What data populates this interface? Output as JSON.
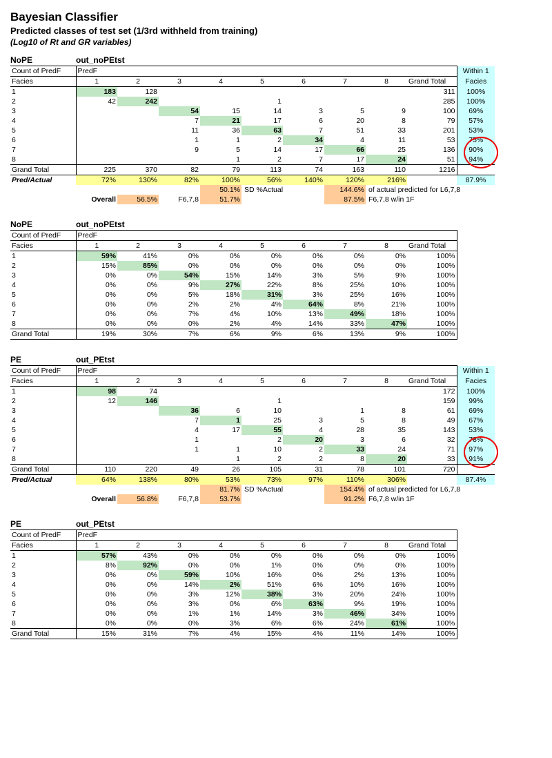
{
  "title": "Bayesian Classifier",
  "subtitle": "Predicted classes of test set (1/3rd withheld from training)",
  "subtitle2": "(Log10 of Rt and GR variables)",
  "labels": {
    "count": "Count of PredF",
    "predf": "PredF",
    "facies": "Facies",
    "gt": "Grand Total",
    "w1f": "Within 1 Facies",
    "pa": "Pred/Actual",
    "sd": "SD %Actual",
    "overall": "Overall",
    "f678": "F6,7,8",
    "note_act": "of actual predicted for L6,7,8",
    "note_w1f": "F6,7,8 w/in 1F"
  },
  "sections": [
    {
      "name": "NoPE",
      "dataset": "out_noPEtst",
      "rows": [
        {
          "f": 1,
          "v": [
            "183",
            "128",
            "",
            "",
            "",
            "",
            "",
            ""
          ],
          "gt": "311",
          "w": "100%",
          "d": 0
        },
        {
          "f": 2,
          "v": [
            "42",
            "242",
            "",
            "",
            "1",
            "",
            "",
            ""
          ],
          "gt": "285",
          "w": "100%",
          "d": 1
        },
        {
          "f": 3,
          "v": [
            "",
            "",
            "54",
            "15",
            "14",
            "3",
            "5",
            "9"
          ],
          "gt": "100",
          "w": "69%",
          "d": 2
        },
        {
          "f": 4,
          "v": [
            "",
            "",
            "7",
            "21",
            "17",
            "6",
            "20",
            "8"
          ],
          "gt": "79",
          "w": "57%",
          "d": 3
        },
        {
          "f": 5,
          "v": [
            "",
            "",
            "11",
            "36",
            "63",
            "7",
            "51",
            "33"
          ],
          "gt": "201",
          "w": "53%",
          "d": 4
        },
        {
          "f": 6,
          "v": [
            "",
            "",
            "1",
            "1",
            "2",
            "34",
            "4",
            "11"
          ],
          "gt": "53",
          "w": "75%",
          "d": 5
        },
        {
          "f": 7,
          "v": [
            "",
            "",
            "9",
            "5",
            "14",
            "17",
            "66",
            "25"
          ],
          "gt": "136",
          "w": "90%",
          "d": 6
        },
        {
          "f": 8,
          "v": [
            "",
            "",
            "",
            "1",
            "2",
            "7",
            "17",
            "24"
          ],
          "gt": "51",
          "w": "94%",
          "d": 7,
          "circ": true
        }
      ],
      "gtrow": [
        "225",
        "370",
        "82",
        "79",
        "113",
        "74",
        "163",
        "110",
        "1216"
      ],
      "pa": [
        "72%",
        "130%",
        "82%",
        "100%",
        "56%",
        "140%",
        "120%",
        "216%",
        "",
        "87.9%"
      ],
      "mid1": {
        "v4": "50.1%",
        "sd": "SD %Actual",
        "v7": "144.6%",
        "note": "of actual predicted for L6,7,8"
      },
      "mid2": {
        "ov": "Overall",
        "ovv": "56.5%",
        "f": "F6,7,8",
        "v4": "51.7%",
        "v7": "87.5%",
        "note": "F6,7,8 w/in 1F"
      }
    },
    {
      "name": "NoPE",
      "dataset": "out_noPEtst",
      "pct": true,
      "rows": [
        {
          "f": 1,
          "v": [
            "59%",
            "41%",
            "0%",
            "0%",
            "0%",
            "0%",
            "0%",
            "0%"
          ],
          "gt": "100%",
          "d": 0
        },
        {
          "f": 2,
          "v": [
            "15%",
            "85%",
            "0%",
            "0%",
            "0%",
            "0%",
            "0%",
            "0%"
          ],
          "gt": "100%",
          "d": 1
        },
        {
          "f": 3,
          "v": [
            "0%",
            "0%",
            "54%",
            "15%",
            "14%",
            "3%",
            "5%",
            "9%"
          ],
          "gt": "100%",
          "d": 2
        },
        {
          "f": 4,
          "v": [
            "0%",
            "0%",
            "9%",
            "27%",
            "22%",
            "8%",
            "25%",
            "10%"
          ],
          "gt": "100%",
          "d": 3
        },
        {
          "f": 5,
          "v": [
            "0%",
            "0%",
            "5%",
            "18%",
            "31%",
            "3%",
            "25%",
            "16%"
          ],
          "gt": "100%",
          "d": 4
        },
        {
          "f": 6,
          "v": [
            "0%",
            "0%",
            "2%",
            "2%",
            "4%",
            "64%",
            "8%",
            "21%"
          ],
          "gt": "100%",
          "d": 5
        },
        {
          "f": 7,
          "v": [
            "0%",
            "0%",
            "7%",
            "4%",
            "10%",
            "13%",
            "49%",
            "18%"
          ],
          "gt": "100%",
          "d": 6
        },
        {
          "f": 8,
          "v": [
            "0%",
            "0%",
            "0%",
            "2%",
            "4%",
            "14%",
            "33%",
            "47%"
          ],
          "gt": "100%",
          "d": 7
        }
      ],
      "gtrow": [
        "19%",
        "30%",
        "7%",
        "6%",
        "9%",
        "6%",
        "13%",
        "9%",
        "100%"
      ]
    },
    {
      "name": "PE",
      "dataset": "out_PEtst",
      "rows": [
        {
          "f": 1,
          "v": [
            "98",
            "74",
            "",
            "",
            "",
            "",
            "",
            ""
          ],
          "gt": "172",
          "w": "100%",
          "d": 0
        },
        {
          "f": 2,
          "v": [
            "12",
            "146",
            "",
            "",
            "1",
            "",
            "",
            ""
          ],
          "gt": "159",
          "w": "99%",
          "d": 1
        },
        {
          "f": 3,
          "v": [
            "",
            "",
            "36",
            "6",
            "10",
            "",
            "1",
            "8"
          ],
          "gt": "61",
          "w": "69%",
          "d": 2
        },
        {
          "f": 4,
          "v": [
            "",
            "",
            "7",
            "1",
            "25",
            "3",
            "5",
            "8"
          ],
          "gt": "49",
          "w": "67%",
          "d": 3
        },
        {
          "f": 5,
          "v": [
            "",
            "",
            "4",
            "17",
            "55",
            "4",
            "28",
            "35"
          ],
          "gt": "143",
          "w": "53%",
          "d": 4
        },
        {
          "f": 6,
          "v": [
            "",
            "",
            "1",
            "",
            "2",
            "20",
            "3",
            "6"
          ],
          "gt": "32",
          "w": "78%",
          "d": 5
        },
        {
          "f": 7,
          "v": [
            "",
            "",
            "1",
            "1",
            "10",
            "2",
            "33",
            "24"
          ],
          "gt": "71",
          "w": "97%",
          "d": 6
        },
        {
          "f": 8,
          "v": [
            "",
            "",
            "",
            "1",
            "2",
            "2",
            "8",
            "20"
          ],
          "gt": "33",
          "w": "91%",
          "d": 7,
          "circ": true
        }
      ],
      "gtrow": [
        "110",
        "220",
        "49",
        "26",
        "105",
        "31",
        "78",
        "101",
        "720"
      ],
      "pa": [
        "64%",
        "138%",
        "80%",
        "53%",
        "73%",
        "97%",
        "110%",
        "306%",
        "",
        "87.4%"
      ],
      "mid1": {
        "v4": "81.7%",
        "sd": "SD %Actual",
        "v7": "154.4%",
        "note": "of actual predicted for L6,7,8"
      },
      "mid2": {
        "ov": "Overall",
        "ovv": "56.8%",
        "f": "F6,7,8",
        "v4": "53.7%",
        "v7": "91.2%",
        "note": "F6,7,8 w/in 1F"
      }
    },
    {
      "name": "PE",
      "dataset": "out_PEtst",
      "pct": true,
      "rows": [
        {
          "f": 1,
          "v": [
            "57%",
            "43%",
            "0%",
            "0%",
            "0%",
            "0%",
            "0%",
            "0%"
          ],
          "gt": "100%",
          "d": 0
        },
        {
          "f": 2,
          "v": [
            "8%",
            "92%",
            "0%",
            "0%",
            "1%",
            "0%",
            "0%",
            "0%"
          ],
          "gt": "100%",
          "d": 1
        },
        {
          "f": 3,
          "v": [
            "0%",
            "0%",
            "59%",
            "10%",
            "16%",
            "0%",
            "2%",
            "13%"
          ],
          "gt": "100%",
          "d": 2
        },
        {
          "f": 4,
          "v": [
            "0%",
            "0%",
            "14%",
            "2%",
            "51%",
            "6%",
            "10%",
            "16%"
          ],
          "gt": "100%",
          "d": 3
        },
        {
          "f": 5,
          "v": [
            "0%",
            "0%",
            "3%",
            "12%",
            "38%",
            "3%",
            "20%",
            "24%"
          ],
          "gt": "100%",
          "d": 4
        },
        {
          "f": 6,
          "v": [
            "0%",
            "0%",
            "3%",
            "0%",
            "6%",
            "63%",
            "9%",
            "19%"
          ],
          "gt": "100%",
          "d": 5
        },
        {
          "f": 7,
          "v": [
            "0%",
            "0%",
            "1%",
            "1%",
            "14%",
            "3%",
            "46%",
            "34%"
          ],
          "gt": "100%",
          "d": 6
        },
        {
          "f": 8,
          "v": [
            "0%",
            "0%",
            "0%",
            "3%",
            "6%",
            "6%",
            "24%",
            "61%"
          ],
          "gt": "100%",
          "d": 7
        }
      ],
      "gtrow": [
        "15%",
        "31%",
        "7%",
        "4%",
        "15%",
        "4%",
        "11%",
        "14%",
        "100%"
      ]
    }
  ]
}
